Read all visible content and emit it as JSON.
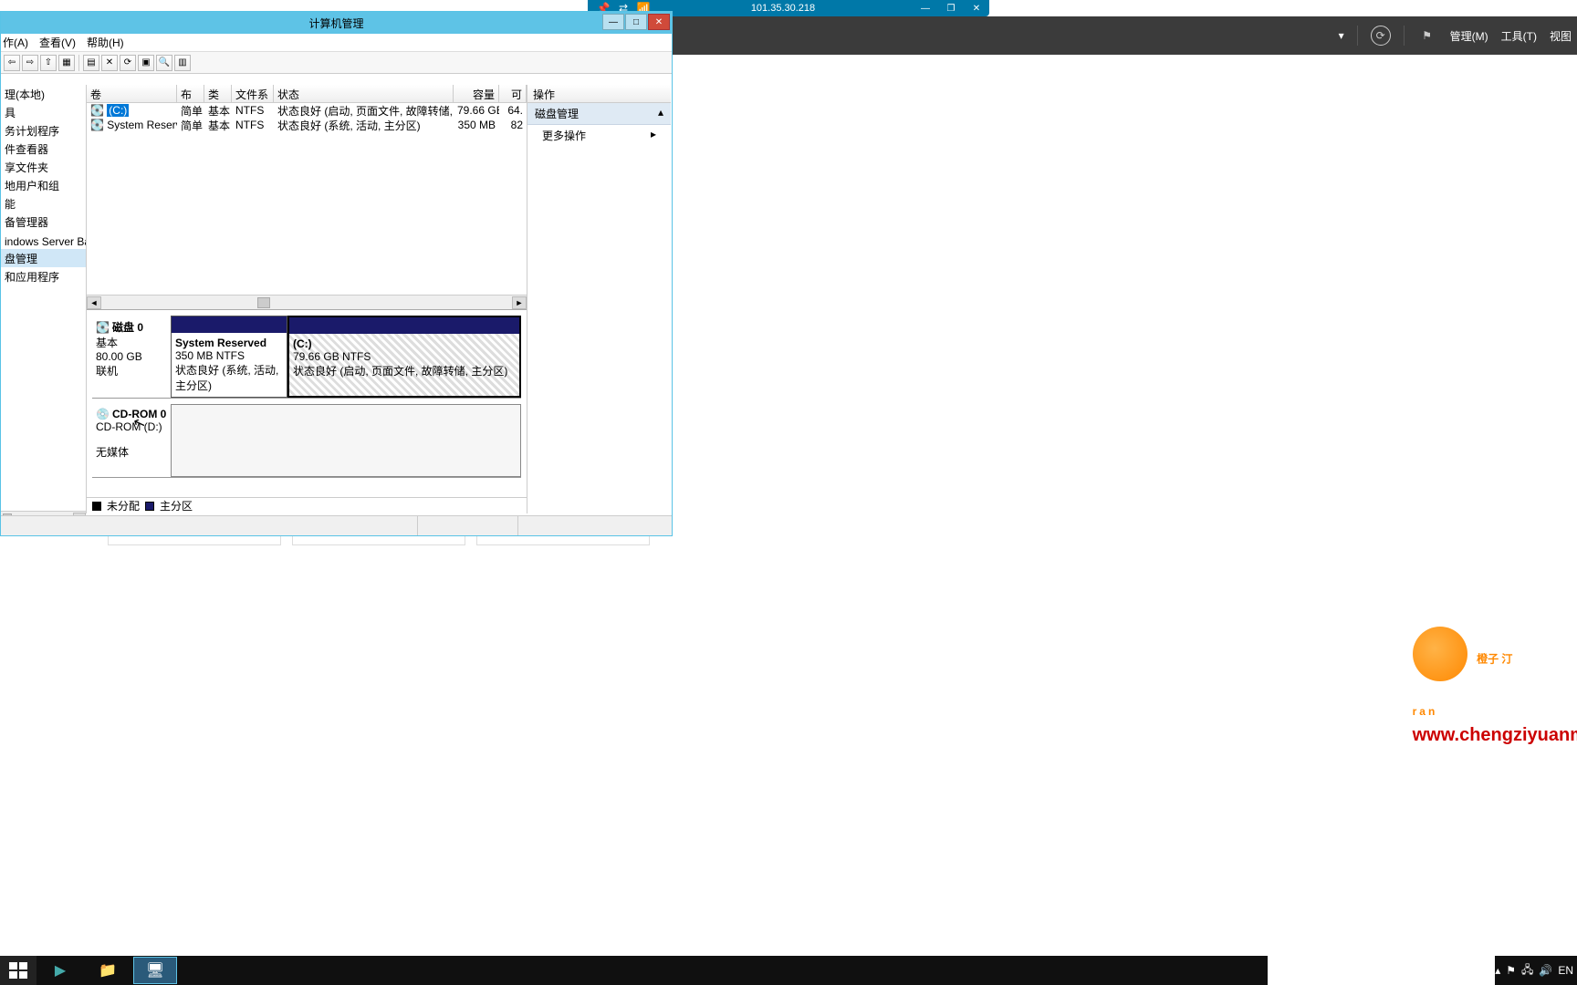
{
  "remote": {
    "ip": "101.35.30.218"
  },
  "srvmgr": {
    "manage": "管理(M)",
    "tools": "工具(T)",
    "view": "视图"
  },
  "window": {
    "title": "计算机管理"
  },
  "menu": {
    "action": "作(A)",
    "view": "查看(V)",
    "help": "帮助(H)"
  },
  "tree": {
    "items": [
      "理(本地)",
      "具",
      "务计划程序",
      "件查看器",
      "享文件夹",
      "地用户和组",
      "能",
      "备管理器",
      "",
      "indows Server Back",
      "盘管理",
      "和应用程序"
    ],
    "selected": 10
  },
  "volumeTable": {
    "headers": {
      "vol": "卷",
      "layout": "布局",
      "type": "类型",
      "fs": "文件系统",
      "status": "状态",
      "cap": "容量",
      "avail": "可用"
    },
    "rows": [
      {
        "vol": "(C:)",
        "layout": "简单",
        "type": "基本",
        "fs": "NTFS",
        "status": "状态良好 (启动, 页面文件, 故障转储, 主分区)",
        "cap": "79.66 GB",
        "avail": "64.",
        "selected": true
      },
      {
        "vol": "System Reserved",
        "layout": "简单",
        "type": "基本",
        "fs": "NTFS",
        "status": "状态良好 (系统, 活动, 主分区)",
        "cap": "350 MB",
        "avail": "82 "
      }
    ]
  },
  "disks": {
    "disk0": {
      "name": "磁盘 0",
      "kind": "基本",
      "size": "80.00 GB",
      "state": "联机",
      "partitions": [
        {
          "name": "System Reserved",
          "size": "350 MB NTFS",
          "status": "状态良好 (系统, 活动, 主分区)"
        },
        {
          "name": "(C:)",
          "size": "79.66 GB NTFS",
          "status": "状态良好 (启动, 页面文件, 故障转储, 主分区)",
          "selected": true
        }
      ]
    },
    "cdrom": {
      "name": "CD-ROM 0",
      "drive": "CD-ROM (D:)",
      "state": "无媒体"
    }
  },
  "legend": {
    "unalloc": "未分配",
    "primary": "主分区"
  },
  "actions": {
    "head": "操作",
    "cat": "磁盘管理",
    "more": "更多操作"
  },
  "taskbar": {
    "lang": "EN"
  },
  "watermark": {
    "text": "橙子 汀",
    "brand": "ran",
    "url": "www.chengziyuanm"
  }
}
